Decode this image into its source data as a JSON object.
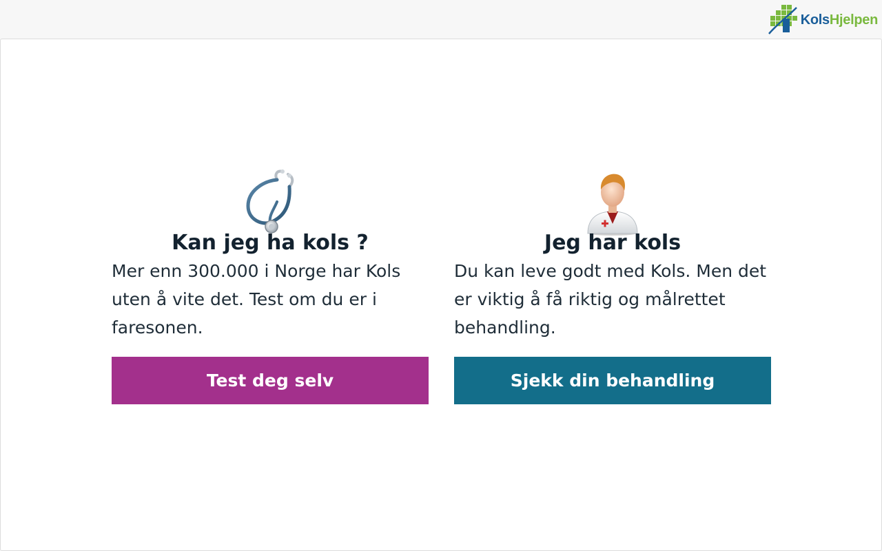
{
  "header": {
    "logo_part1": "Kols",
    "logo_part2": "Hjelpen",
    "logo_icon": "green-cross-grid-logo-icon"
  },
  "cards": [
    {
      "icon": "stethoscope-icon",
      "title": "Kan jeg ha kols ?",
      "text": "Mer enn 300.000 i Norge har Kols uten å vite det. Test om du er i faresonen.",
      "button_label": "Test deg selv",
      "button_color": "#a3308c"
    },
    {
      "icon": "doctor-icon",
      "title": "Jeg har kols",
      "text": "Du kan leve godt med Kols. Men det er viktig å få riktig og målrettet behandling.",
      "button_label": "Sjekk din behandling",
      "button_color": "#136e8a"
    }
  ],
  "colors": {
    "brand_blue": "#1a5e9a",
    "brand_green": "#7ab93f",
    "text_dark": "#13222f"
  }
}
